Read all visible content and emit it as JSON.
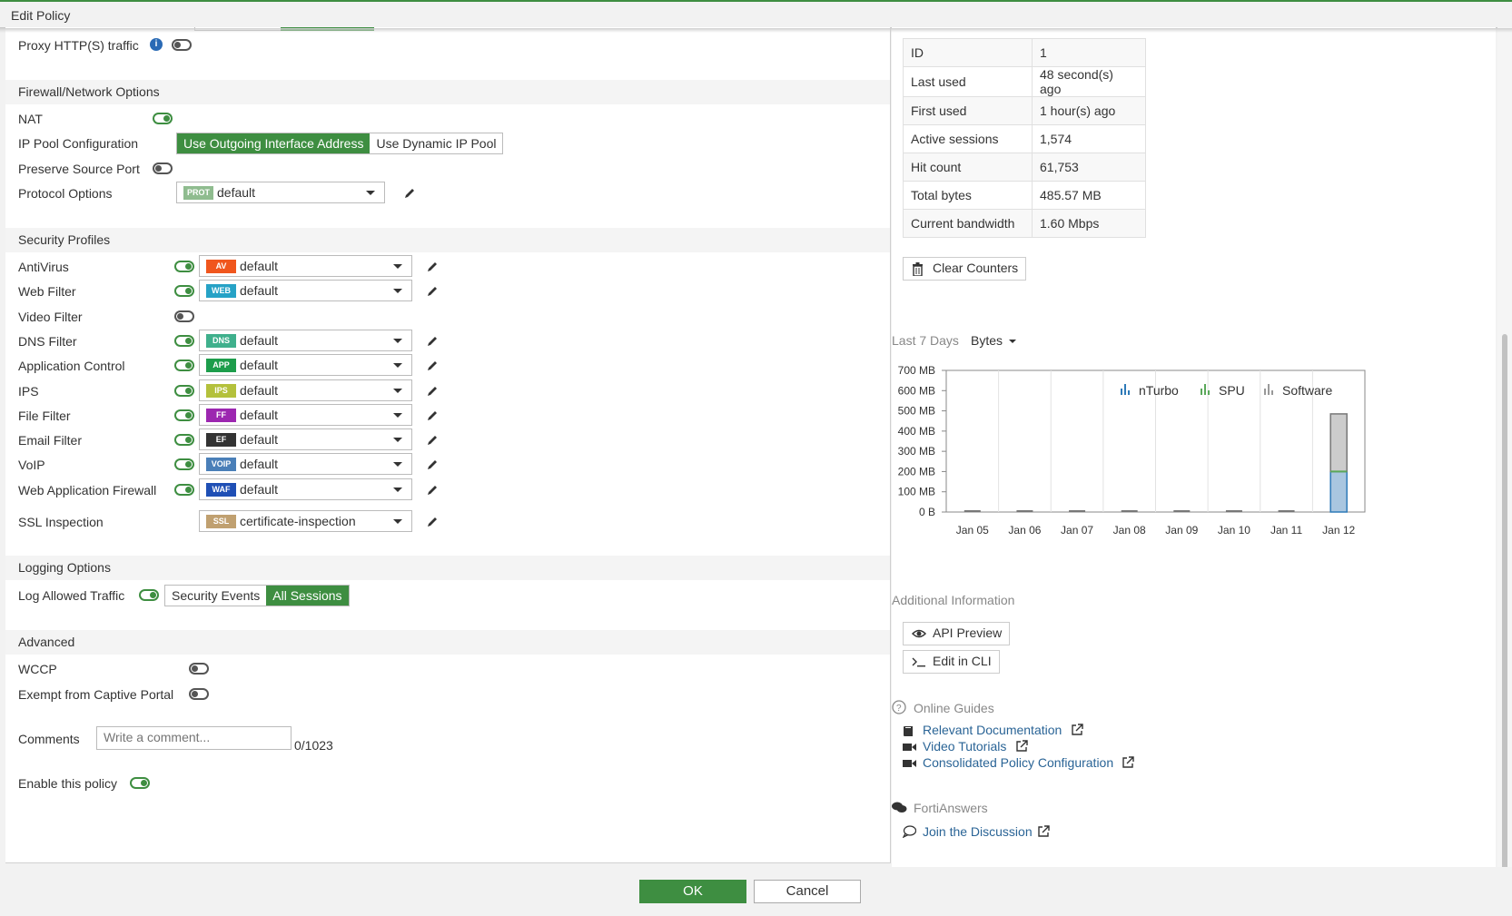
{
  "window": {
    "title": "Edit Policy"
  },
  "top": {
    "proxy_label": "Proxy HTTP(S) traffic"
  },
  "firewall": {
    "header": "Firewall/Network Options",
    "nat_label": "NAT",
    "ip_pool_label": "IP Pool Configuration",
    "ip_pool_options": [
      "Use Outgoing Interface Address",
      "Use Dynamic IP Pool"
    ],
    "preserve_port_label": "Preserve Source Port",
    "protocol_label": "Protocol Options",
    "protocol_badge": "PROT",
    "protocol_value": "default"
  },
  "security": {
    "header": "Security Profiles",
    "profiles": [
      {
        "label": "AntiVirus",
        "badge": "AV",
        "color": "#f0561d",
        "value": "default",
        "enabled": true
      },
      {
        "label": "Web Filter",
        "badge": "WEB",
        "color": "#26a2c6",
        "value": "default",
        "enabled": true
      },
      {
        "label": "Video Filter",
        "badge": "",
        "color": "",
        "value": "",
        "enabled": false
      },
      {
        "label": "DNS Filter",
        "badge": "DNS",
        "color": "#3fb08c",
        "value": "default",
        "enabled": true
      },
      {
        "label": "Application Control",
        "badge": "APP",
        "color": "#1d9d4b",
        "value": "default",
        "enabled": true
      },
      {
        "label": "IPS",
        "badge": "IPS",
        "color": "#b4c13c",
        "value": "default",
        "enabled": true
      },
      {
        "label": "File Filter",
        "badge": "FF",
        "color": "#9c27b0",
        "value": "default",
        "enabled": true
      },
      {
        "label": "Email Filter",
        "badge": "EF",
        "color": "#333333",
        "value": "default",
        "enabled": true
      },
      {
        "label": "VoIP",
        "badge": "VOIP",
        "color": "#4a7fb8",
        "value": "default",
        "enabled": true
      },
      {
        "label": "Web Application Firewall",
        "badge": "WAF",
        "color": "#1f4fb5",
        "value": "default",
        "enabled": true
      }
    ],
    "ssl_label": "SSL Inspection",
    "ssl_badge": "SSL",
    "ssl_color": "#c0a070",
    "ssl_value": "certificate-inspection"
  },
  "logging": {
    "header": "Logging Options",
    "log_label": "Log Allowed Traffic",
    "options": [
      "Security Events",
      "All Sessions"
    ]
  },
  "advanced": {
    "header": "Advanced",
    "wccp_label": "WCCP",
    "captive_label": "Exempt from Captive Portal",
    "comments_label": "Comments",
    "comments_placeholder": "Write a comment...",
    "comments_count": "0/1023",
    "enable_label": "Enable this policy"
  },
  "stats": {
    "rows": [
      {
        "k": "ID",
        "v": "1"
      },
      {
        "k": "Last used",
        "v": "48 second(s) ago"
      },
      {
        "k": "First used",
        "v": "1 hour(s) ago"
      },
      {
        "k": "Active sessions",
        "v": "1,574"
      },
      {
        "k": "Hit count",
        "v": "61,753"
      },
      {
        "k": "Total bytes",
        "v": "485.57 MB"
      },
      {
        "k": "Current bandwidth",
        "v": "1.60 Mbps"
      }
    ],
    "clear_label": "Clear Counters"
  },
  "chart_controls": {
    "range_label": "Last 7 Days",
    "metric_label": "Bytes"
  },
  "chart_data": {
    "type": "bar",
    "stacked": true,
    "categories": [
      "Jan 05",
      "Jan 06",
      "Jan 07",
      "Jan 08",
      "Jan 09",
      "Jan 10",
      "Jan 11",
      "Jan 12"
    ],
    "series": [
      {
        "name": "nTurbo",
        "color": "#2e7ab8",
        "values": [
          0,
          0,
          0,
          0,
          0,
          0,
          0,
          0
        ]
      },
      {
        "name": "SPU",
        "color": "#5aa85a",
        "values": [
          0,
          0,
          0,
          0,
          0,
          0,
          0,
          200
        ]
      },
      {
        "name": "Software",
        "color": "#999999",
        "values": [
          0,
          0,
          0,
          0,
          0,
          0,
          0,
          285
        ]
      }
    ],
    "yticks": [
      "0 B",
      "100 MB",
      "200 MB",
      "300 MB",
      "400 MB",
      "500 MB",
      "600 MB",
      "700 MB"
    ],
    "ylim": [
      0,
      700
    ],
    "yunit": "MB",
    "grid": true,
    "legend": "top-right"
  },
  "info": {
    "header": "Additional Information",
    "api_label": "API Preview",
    "cli_label": "Edit in CLI"
  },
  "guides": {
    "header": "Online Guides",
    "links": [
      "Relevant Documentation",
      "Video Tutorials",
      "Consolidated Policy Configuration"
    ]
  },
  "forti": {
    "header": "FortiAnswers",
    "link": "Join the Discussion"
  },
  "footer": {
    "ok": "OK",
    "cancel": "Cancel"
  }
}
